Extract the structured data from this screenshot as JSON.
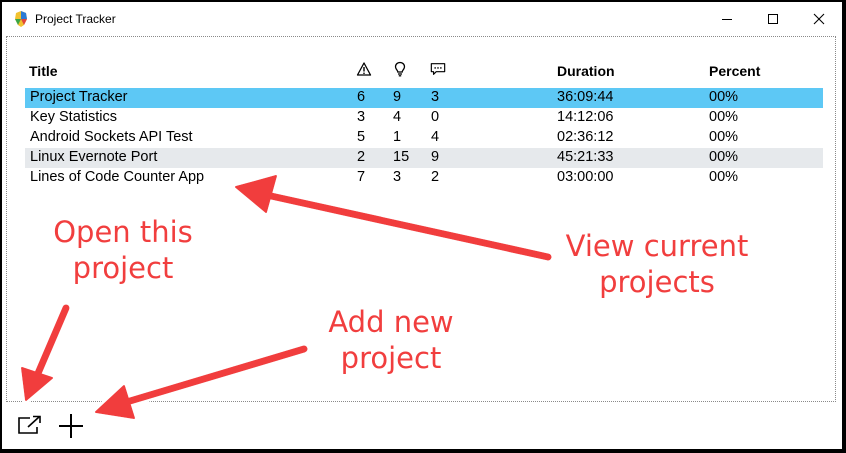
{
  "window": {
    "title": "Project Tracker"
  },
  "table": {
    "headers": {
      "title": "Title",
      "issues_icon": "warning-triangle-icon",
      "ideas_icon": "lightbulb-icon",
      "comments_icon": "comment-icon",
      "duration": "Duration",
      "percent": "Percent"
    },
    "rows": [
      {
        "title": "Project Tracker",
        "issues": "6",
        "ideas": "9",
        "comments": "3",
        "duration": "36:09:44",
        "percent": "00%"
      },
      {
        "title": "Key Statistics",
        "issues": "3",
        "ideas": "4",
        "comments": "0",
        "duration": "14:12:06",
        "percent": "00%"
      },
      {
        "title": "Android Sockets API Test",
        "issues": "5",
        "ideas": "1",
        "comments": "4",
        "duration": "02:36:12",
        "percent": "00%"
      },
      {
        "title": "Linux Evernote Port",
        "issues": "2",
        "ideas": "15",
        "comments": "9",
        "duration": "45:21:33",
        "percent": "00%"
      },
      {
        "title": "Lines of Code Counter App",
        "issues": "7",
        "ideas": "3",
        "comments": "2",
        "duration": "03:00:00",
        "percent": "00%"
      }
    ]
  },
  "annotations": {
    "open_line1": "Open this",
    "open_line2": "project",
    "view_line1": "View current",
    "view_line2": "projects",
    "add_line1": "Add new",
    "add_line2": "project"
  },
  "colors": {
    "selected_row": "#5dc8f5",
    "alt_row": "#e6e9ec",
    "annotation": "#f13e3e"
  }
}
